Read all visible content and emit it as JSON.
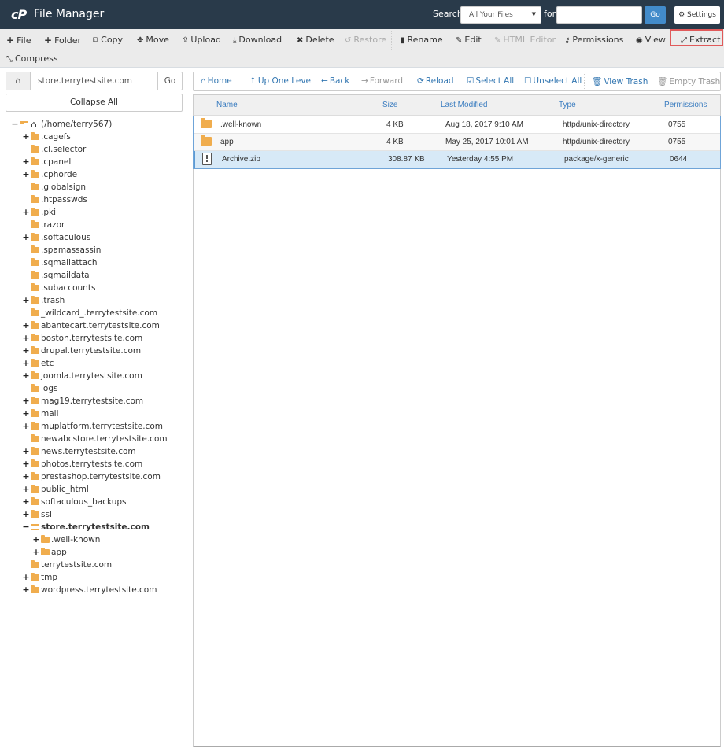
{
  "header": {
    "logo": "cP",
    "title": "File Manager",
    "search_label": "Search",
    "search_scope": "All Your Files",
    "for_label": "for",
    "search_value": "",
    "go_label": "Go",
    "settings_label": "Settings"
  },
  "toolbar": {
    "file": "File",
    "folder": "Folder",
    "copy": "Copy",
    "move": "Move",
    "upload": "Upload",
    "download": "Download",
    "delete": "Delete",
    "restore": "Restore",
    "rename": "Rename",
    "edit": "Edit",
    "html_editor": "HTML Editor",
    "permissions": "Permissions",
    "view": "View",
    "extract": "Extract",
    "compress": "Compress"
  },
  "path_bar": {
    "value": "store.terrytestsite.com",
    "go_label": "Go"
  },
  "collapse_all": "Collapse All",
  "tree": [
    {
      "label": "(/home/terry567)",
      "depth": 0,
      "toggle": "−",
      "open": true,
      "home": true
    },
    {
      "label": ".cagefs",
      "depth": 1,
      "toggle": "+"
    },
    {
      "label": ".cl.selector",
      "depth": 1,
      "toggle": ""
    },
    {
      "label": ".cpanel",
      "depth": 1,
      "toggle": "+"
    },
    {
      "label": ".cphorde",
      "depth": 1,
      "toggle": "+"
    },
    {
      "label": ".globalsign",
      "depth": 1,
      "toggle": ""
    },
    {
      "label": ".htpasswds",
      "depth": 1,
      "toggle": ""
    },
    {
      "label": ".pki",
      "depth": 1,
      "toggle": "+"
    },
    {
      "label": ".razor",
      "depth": 1,
      "toggle": ""
    },
    {
      "label": ".softaculous",
      "depth": 1,
      "toggle": "+"
    },
    {
      "label": ".spamassassin",
      "depth": 1,
      "toggle": ""
    },
    {
      "label": ".sqmailattach",
      "depth": 1,
      "toggle": ""
    },
    {
      "label": ".sqmaildata",
      "depth": 1,
      "toggle": ""
    },
    {
      "label": ".subaccounts",
      "depth": 1,
      "toggle": ""
    },
    {
      "label": ".trash",
      "depth": 1,
      "toggle": "+"
    },
    {
      "label": "_wildcard_.terrytestsite.com",
      "depth": 1,
      "toggle": ""
    },
    {
      "label": "abantecart.terrytestsite.com",
      "depth": 1,
      "toggle": "+"
    },
    {
      "label": "boston.terrytestsite.com",
      "depth": 1,
      "toggle": "+"
    },
    {
      "label": "drupal.terrytestsite.com",
      "depth": 1,
      "toggle": "+"
    },
    {
      "label": "etc",
      "depth": 1,
      "toggle": "+"
    },
    {
      "label": "joomla.terrytestsite.com",
      "depth": 1,
      "toggle": "+"
    },
    {
      "label": "logs",
      "depth": 1,
      "toggle": ""
    },
    {
      "label": "mag19.terrytestsite.com",
      "depth": 1,
      "toggle": "+"
    },
    {
      "label": "mail",
      "depth": 1,
      "toggle": "+"
    },
    {
      "label": "muplatform.terrytestsite.com",
      "depth": 1,
      "toggle": "+"
    },
    {
      "label": "newabcstore.terrytestsite.com",
      "depth": 1,
      "toggle": ""
    },
    {
      "label": "news.terrytestsite.com",
      "depth": 1,
      "toggle": "+"
    },
    {
      "label": "photos.terrytestsite.com",
      "depth": 1,
      "toggle": "+"
    },
    {
      "label": "prestashop.terrytestsite.com",
      "depth": 1,
      "toggle": "+"
    },
    {
      "label": "public_html",
      "depth": 1,
      "toggle": "+"
    },
    {
      "label": "softaculous_backups",
      "depth": 1,
      "toggle": "+"
    },
    {
      "label": "ssl",
      "depth": 1,
      "toggle": "+"
    },
    {
      "label": "store.terrytestsite.com",
      "depth": 1,
      "toggle": "−",
      "open": true,
      "bold": true
    },
    {
      "label": ".well-known",
      "depth": 2,
      "toggle": "+"
    },
    {
      "label": "app",
      "depth": 2,
      "toggle": "+"
    },
    {
      "label": "terrytestsite.com",
      "depth": 1,
      "toggle": ""
    },
    {
      "label": "tmp",
      "depth": 1,
      "toggle": "+"
    },
    {
      "label": "wordpress.terrytestsite.com",
      "depth": 1,
      "toggle": "+"
    }
  ],
  "nav": {
    "home": "Home",
    "up": "Up One Level",
    "back": "Back",
    "forward": "Forward",
    "reload": "Reload",
    "select_all": "Select All",
    "unselect_all": "Unselect All",
    "view_trash": "View Trash",
    "empty_trash": "Empty Trash"
  },
  "table": {
    "columns": [
      "Name",
      "Size",
      "Last Modified",
      "Type",
      "Permissions"
    ],
    "rows": [
      {
        "icon": "folder",
        "name": ".well-known",
        "size": "4 KB",
        "modified": "Aug 18, 2017 9:10 AM",
        "type": "httpd/unix-directory",
        "perms": "0755",
        "selected": false
      },
      {
        "icon": "folder",
        "name": "app",
        "size": "4 KB",
        "modified": "May 25, 2017 10:01 AM",
        "type": "httpd/unix-directory",
        "perms": "0755",
        "selected": false
      },
      {
        "icon": "zip",
        "name": "Archive.zip",
        "size": "308.87 KB",
        "modified": "Yesterday 4:55 PM",
        "type": "package/x-generic",
        "perms": "0644",
        "selected": true
      }
    ]
  },
  "colors": {
    "topbar": "#293a4a",
    "link": "#3276b1",
    "folder": "#f0ad4e",
    "selected_row": "#d7e9f7",
    "highlight_border": "#e05a5a",
    "go_button": "#428bca"
  }
}
